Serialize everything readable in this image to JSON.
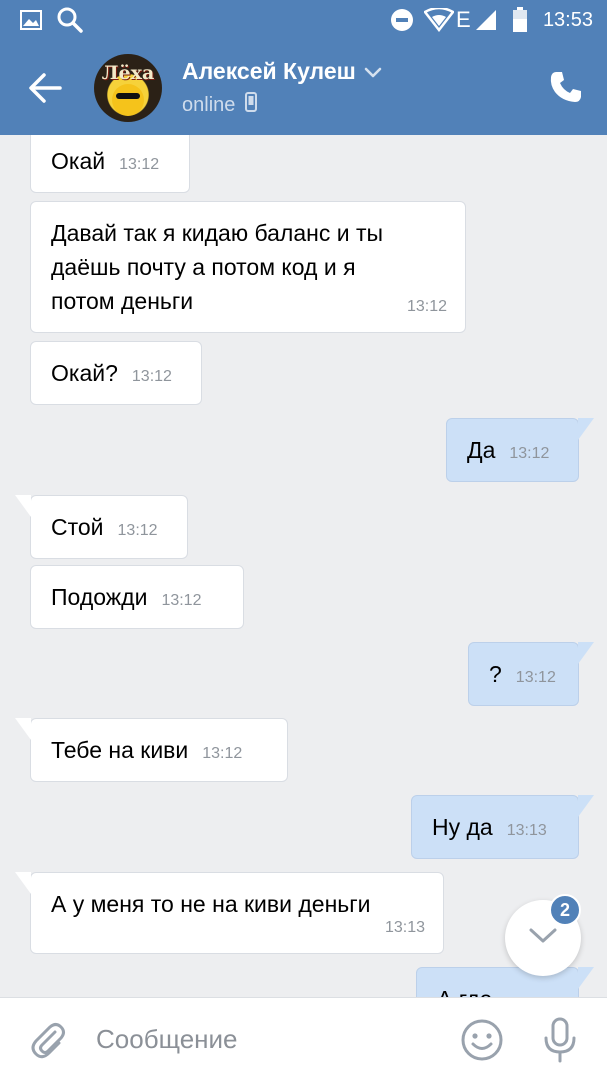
{
  "statusbar": {
    "time": "13:53",
    "network": "E"
  },
  "header": {
    "name": "Алексей Кулеш",
    "status": "online",
    "avatar_text": "Лёха"
  },
  "messages": [
    {
      "dir": "in",
      "text": "Окай",
      "time": "13:12"
    },
    {
      "dir": "in",
      "lines": [
        "Давай так я кидаю баланс и ты",
        "даёшь почту а потом код и я",
        "потом деньги"
      ],
      "time": "13:12"
    },
    {
      "dir": "in",
      "text": "Окай?",
      "time": "13:12"
    },
    {
      "dir": "out",
      "text": "Да",
      "time": "13:12"
    },
    {
      "dir": "in",
      "text": "Стой",
      "time": "13:12"
    },
    {
      "dir": "in",
      "text": "Подожди",
      "time": "13:12"
    },
    {
      "dir": "out",
      "text": "?",
      "time": "13:12"
    },
    {
      "dir": "in",
      "text": "Тебе на киви",
      "time": "13:12"
    },
    {
      "dir": "out",
      "text": "Ну да",
      "time": "13:13"
    },
    {
      "dir": "in",
      "text": "А у меня то не на киви деньги",
      "time": "13:13"
    },
    {
      "dir": "out",
      "text": "А где",
      "time": ""
    }
  ],
  "scroll": {
    "unread_count": "2"
  },
  "composer": {
    "placeholder": "Сообщение"
  }
}
